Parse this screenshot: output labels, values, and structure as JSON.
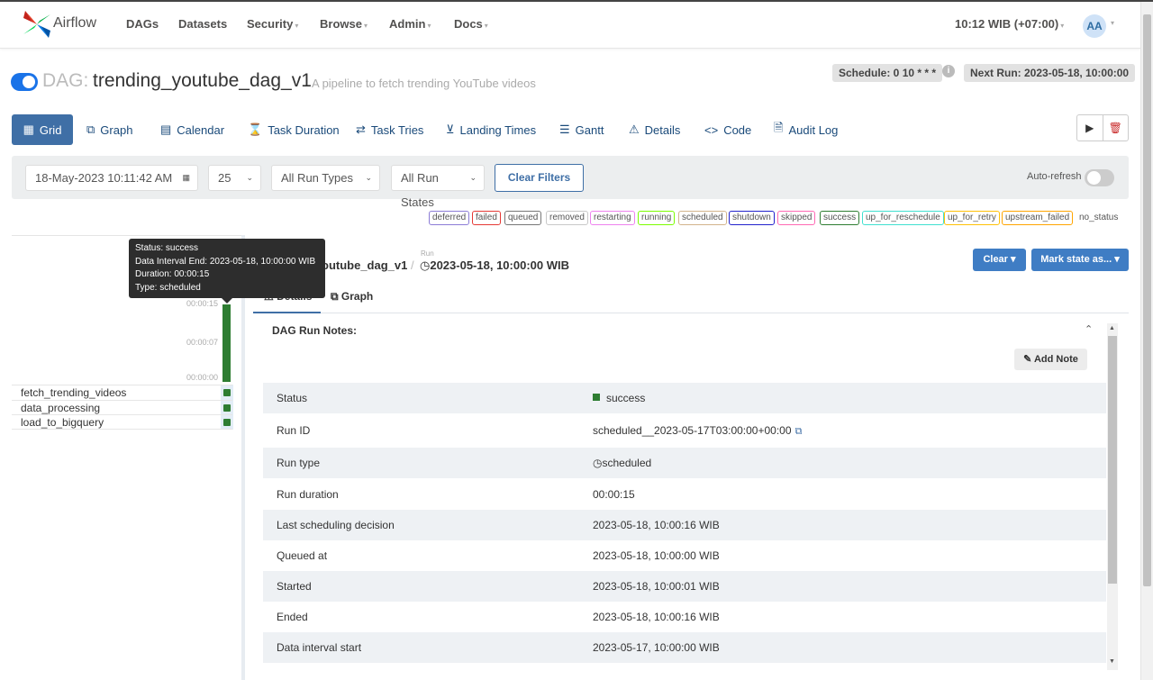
{
  "navbar": {
    "brand": "Airflow",
    "items": [
      {
        "label": "DAGs",
        "dropdown": false
      },
      {
        "label": "Datasets",
        "dropdown": false
      },
      {
        "label": "Security",
        "dropdown": true
      },
      {
        "label": "Browse",
        "dropdown": true
      },
      {
        "label": "Admin",
        "dropdown": true
      },
      {
        "label": "Docs",
        "dropdown": true
      }
    ],
    "time": "10:12 WIB (+07:00)",
    "avatar": "AA"
  },
  "dag": {
    "prefix": "DAG:",
    "name": "trending_youtube_dag_v1",
    "description": "A pipeline to fetch trending YouTube videos",
    "schedule": "Schedule: 0 10 * * *",
    "next_run": "Next Run: 2023-05-18, 10:00:00"
  },
  "tabs": [
    "Grid",
    "Graph",
    "Calendar",
    "Task Duration",
    "Task Tries",
    "Landing Times",
    "Gantt",
    "Details",
    "Code",
    "Audit Log"
  ],
  "filters": {
    "date": "18-May-2023 10:11:42 AM",
    "num_runs": "25",
    "run_types": "All Run Types",
    "run_states": "All Run States",
    "clear_filters": "Clear Filters",
    "auto_refresh": "Auto-refresh"
  },
  "legend": [
    {
      "label": "deferred",
      "color": "#8c7cd6"
    },
    {
      "label": "failed",
      "color": "#e53935"
    },
    {
      "label": "queued",
      "color": "#777777"
    },
    {
      "label": "removed",
      "color": "#c8c8c8"
    },
    {
      "label": "restarting",
      "color": "#ee82ee"
    },
    {
      "label": "running",
      "color": "#7cfc00"
    },
    {
      "label": "scheduled",
      "color": "#d2b48c"
    },
    {
      "label": "shutdown",
      "color": "#2222cc"
    },
    {
      "label": "skipped",
      "color": "#ff69b4"
    },
    {
      "label": "success",
      "color": "#2e7d32"
    },
    {
      "label": "up_for_reschedule",
      "color": "#40e0d0"
    },
    {
      "label": "up_for_retry",
      "color": "#ffc107"
    },
    {
      "label": "upstream_failed",
      "color": "#ffa500"
    },
    {
      "label": "no_status",
      "color": "none"
    }
  ],
  "grid": {
    "duration_ticks": [
      "00:00:15",
      "00:00:07",
      "00:00:00"
    ],
    "tasks": [
      "fetch_trending_videos",
      "data_processing",
      "load_to_bigquery"
    ]
  },
  "tooltip": {
    "status": "Status: success",
    "interval_end": "Data Interval End: 2023-05-18, 10:00:00 WIB",
    "duration": "Duration: 00:00:15",
    "type": "Type: scheduled"
  },
  "details": {
    "crumb_dag": "outube_dag_v1",
    "crumb_sep": "/",
    "crumb_run_label": "Run",
    "crumb_run": "2023-05-18, 10:00:00 WIB",
    "clear_button": "Clear",
    "mark_state_button": "Mark state as...",
    "subtabs": [
      "Details",
      "Graph"
    ],
    "notes_label": "DAG Run Notes:",
    "add_note": "Add Note",
    "rows": [
      {
        "key": "Status",
        "value": "success"
      },
      {
        "key": "Run ID",
        "value": "scheduled__2023-05-17T03:00:00+00:00"
      },
      {
        "key": "Run type",
        "value": "scheduled"
      },
      {
        "key": "Run duration",
        "value": "00:00:15"
      },
      {
        "key": "Last scheduling decision",
        "value": "2023-05-18, 10:00:16 WIB"
      },
      {
        "key": "Queued at",
        "value": "2023-05-18, 10:00:00 WIB"
      },
      {
        "key": "Started",
        "value": "2023-05-18, 10:00:01 WIB"
      },
      {
        "key": "Ended",
        "value": "2023-05-18, 10:00:16 WIB"
      },
      {
        "key": "Data interval start",
        "value": "2023-05-17, 10:00:00 WIB"
      }
    ]
  }
}
